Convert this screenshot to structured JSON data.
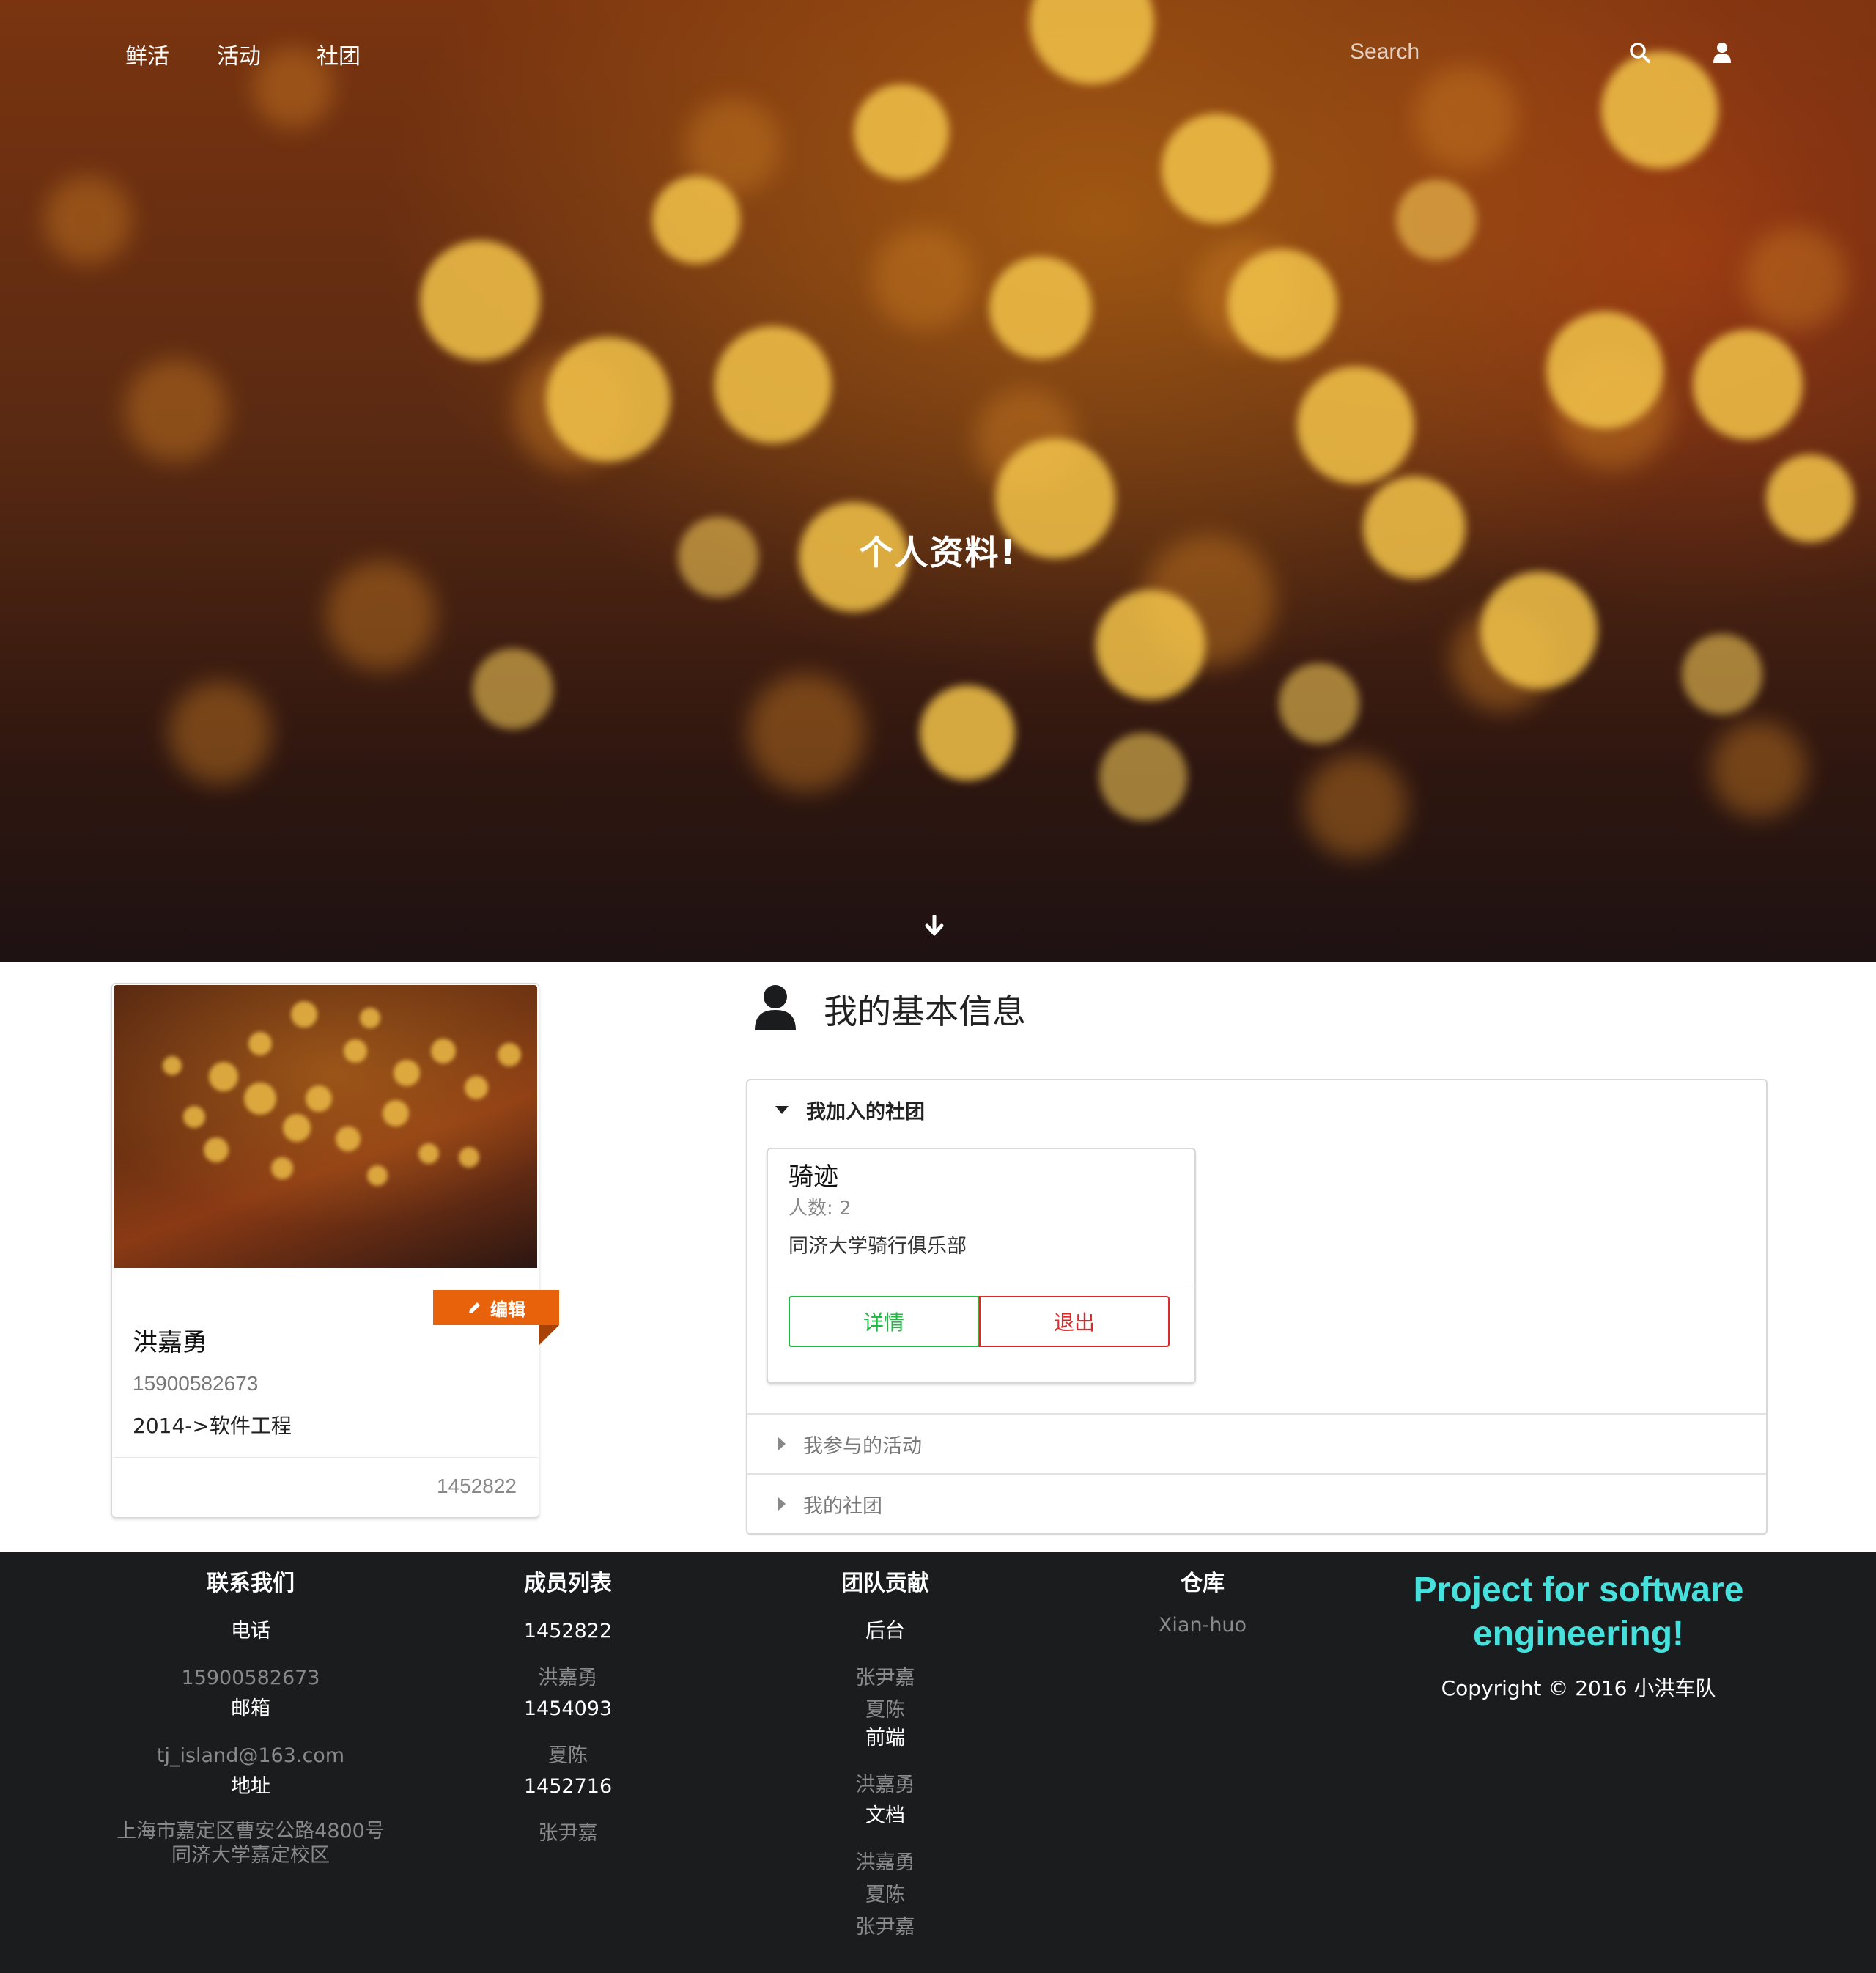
{
  "nav": {
    "links": [
      "鲜活",
      "活动",
      "社团"
    ],
    "search_placeholder": "Search",
    "search_icon": "search-icon",
    "user_icon": "user-icon"
  },
  "hero": {
    "title": "个人资料!",
    "scroll_icon": "arrow-down-icon"
  },
  "profile": {
    "edit_label": "编辑",
    "edit_icon": "pencil-icon",
    "name": "洪嘉勇",
    "phone": "15900582673",
    "major": "2014->软件工程",
    "student_id": "1452822"
  },
  "basic_info": {
    "title": "我的基本信息",
    "icon": "user-icon",
    "sections": [
      {
        "label": "我加入的社团",
        "open": true,
        "clubs": [
          {
            "name": "骑迹",
            "count": "人数: 2",
            "description": "同济大学骑行俱乐部",
            "detail_label": "详情",
            "quit_label": "退出"
          }
        ]
      },
      {
        "label": "我参与的活动",
        "open": false
      },
      {
        "label": "我的社团",
        "open": false
      }
    ]
  },
  "footer": {
    "contact": {
      "title": "联系我们",
      "phone_label": "电话",
      "phone": "15900582673",
      "email_label": "邮箱",
      "email": "tj_island@163.com",
      "address_label": "地址",
      "address_line1": "上海市嘉定区曹安公路4800号",
      "address_line2": "同济大学嘉定校区"
    },
    "members": {
      "title": "成员列表",
      "items": [
        {
          "id": "1452822",
          "name": "洪嘉勇"
        },
        {
          "id": "1454093",
          "name": "夏陈"
        },
        {
          "id": "1452716",
          "name": "张尹嘉"
        }
      ]
    },
    "contribution": {
      "title": "团队贡献",
      "groups": [
        {
          "role": "后台",
          "names": [
            "张尹嘉",
            "夏陈"
          ]
        },
        {
          "role": "前端",
          "names": [
            "洪嘉勇"
          ]
        },
        {
          "role": "文档",
          "names": [
            "洪嘉勇",
            "夏陈",
            "张尹嘉"
          ]
        }
      ]
    },
    "repo": {
      "title": "仓库",
      "name": "Xian-huo"
    },
    "project": {
      "title": "Project for software engineering!",
      "copyright": "Copyright © 2016 小洪车队"
    }
  },
  "colors": {
    "accent_teal": "#46e0dd",
    "edit_orange": "#e8620c",
    "detail_green": "#21ba45",
    "quit_red": "#db2828",
    "footer_bg": "#1b1c1d"
  }
}
